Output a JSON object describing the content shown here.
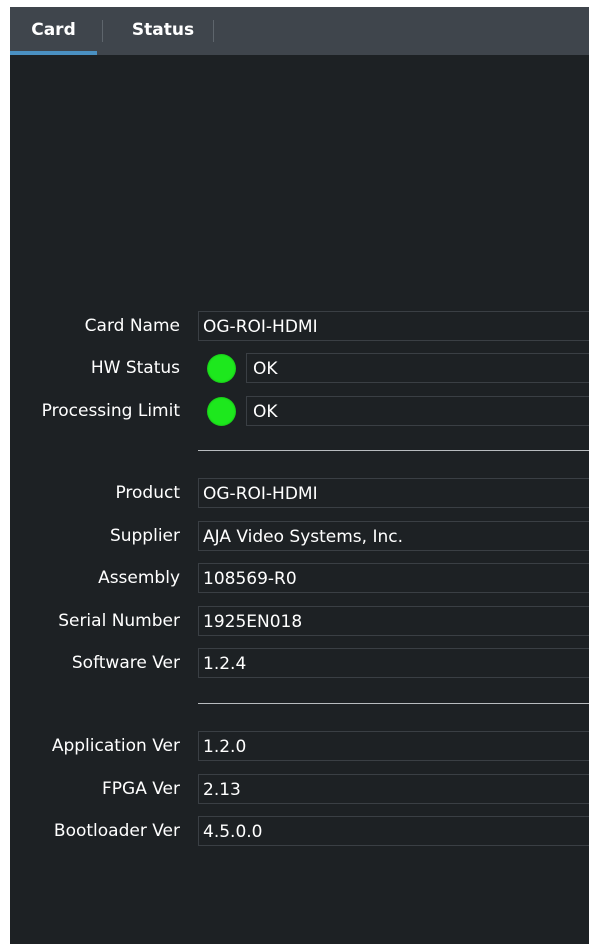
{
  "tabs": [
    {
      "label": "Card",
      "active": true
    },
    {
      "label": "Status",
      "active": false
    }
  ],
  "status_group": [
    {
      "label": "Card Name",
      "value": "OG-ROI-HDMI"
    },
    {
      "label": "HW Status",
      "value": "OK",
      "led_color": "#1de81d"
    },
    {
      "label": "Processing Limit",
      "value": "OK",
      "led_color": "#1de81d"
    }
  ],
  "info_group": [
    {
      "label": "Product",
      "value": "OG-ROI-HDMI"
    },
    {
      "label": "Supplier",
      "value": "AJA Video Systems, Inc."
    },
    {
      "label": "Assembly",
      "value": "108569-R0"
    },
    {
      "label": "Serial Number",
      "value": "1925EN018"
    },
    {
      "label": "Software Ver",
      "value": "1.2.4"
    }
  ],
  "version_group": [
    {
      "label": "Application Ver",
      "value": "1.2.0"
    },
    {
      "label": "FPGA Ver",
      "value": "2.13"
    },
    {
      "label": "Bootloader Ver",
      "value": "4.5.0.0"
    }
  ],
  "colors": {
    "background": "#1d2124",
    "tabbar": "#3f454c",
    "active_tab_underline": "#4a90c2",
    "ok_led": "#1de81d"
  }
}
